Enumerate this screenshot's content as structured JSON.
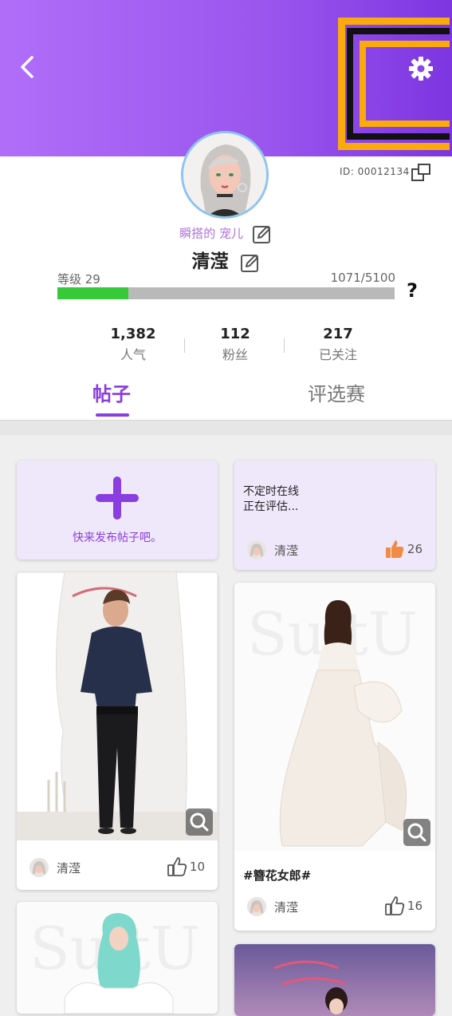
{
  "header": {
    "back_icon": "chevron-left-icon",
    "settings_icon": "gear-icon",
    "gradient": [
      "#b06ef8",
      "#7d35e0"
    ]
  },
  "profile": {
    "id_text": "ID: 00012134",
    "nickname": "瞬搭的 宠儿",
    "username": "清滢",
    "level_label": "等级 29",
    "level_progress_text": "1071/5100",
    "level_progress_fraction": 0.21,
    "help_label": "?"
  },
  "stats": [
    {
      "value": "1,382",
      "label": "人气"
    },
    {
      "value": "112",
      "label": "粉丝"
    },
    {
      "value": "217",
      "label": "已关注"
    }
  ],
  "tabs": [
    {
      "label": "帖子",
      "active": true
    },
    {
      "label": "评选赛",
      "active": false
    }
  ],
  "create_post": {
    "label": "快来发布帖子吧。"
  },
  "status_card": {
    "line1": "不定时在线",
    "line2": "正在评估...",
    "author": "清滢",
    "likes": "26"
  },
  "posts": [
    {
      "author": "清滢",
      "likes": "10",
      "tag": ""
    },
    {
      "author": "清滢",
      "likes": "16",
      "tag": "#簪花女郎#"
    }
  ],
  "colors": {
    "accent": "#8a3de0",
    "progress": "#37c93a",
    "like_active": "#f08a44"
  }
}
